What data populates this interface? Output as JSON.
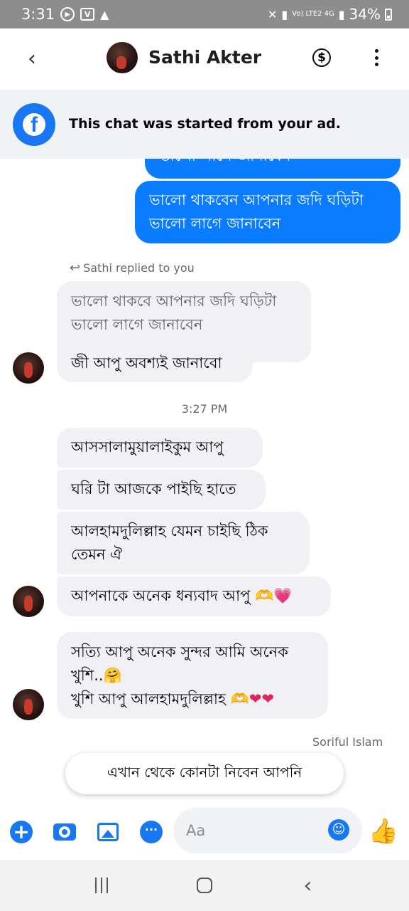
{
  "status_bar": {
    "time": "3:31",
    "battery": "34%",
    "signal_label": "Vo) LTE2 4G"
  },
  "header": {
    "contact_name": "Sathi Akter"
  },
  "ad_banner": {
    "text": "This chat was started from your ad."
  },
  "messages": {
    "out_partial": "ভালো লাগে জানাবেন",
    "out_1_line1": "ভালো থাকবেন আপনার জদি ঘড়িটা",
    "out_1_line2": "ভালো লাগে জানাবেন",
    "reply_note": "Sathi replied to you",
    "quoted_line1": "ভালো থাকবে আপনার জদি ঘড়িটা",
    "quoted_line2": "ভালো লাগে জানাবেন",
    "reply_text": "জী আপু অবশ্যই জানাবো",
    "time_separator": "3:27 PM",
    "in_1": "আসসালামুয়ালাইকুম আপু",
    "in_2": "ঘরি টা আজকে পাইছি হাতে",
    "in_3_line1": "আলহামদুলিল্লাহ যেমন চাইছি ঠিক",
    "in_3_line2": "তেমন ঐ",
    "in_4": "আপনাকে অনেক ধন্যবাদ আপু",
    "in_5_line1": "সত্যি আপু অনেক সুন্দর আমি অনেক",
    "in_5_line2": "খুশি..",
    "in_5_line3": "খুশি আপু আলহামদুলিল্লাহ",
    "sender_label": "Soriful Islam"
  },
  "suggestion": {
    "text": "এখান থেকে কোনটা নিবেন আপনি"
  },
  "composer": {
    "placeholder": "Aa"
  },
  "icons": {
    "back": "chevron-left-icon",
    "payment": "dollar-circle-icon",
    "more": "more-vertical-icon",
    "facebook": "facebook-logo",
    "reply": "reply-arrow-icon",
    "add": "plus-circle-icon",
    "camera": "camera-icon",
    "gallery": "image-icon",
    "chat": "chat-bubble-icon",
    "emoji": "smile-icon",
    "like": "thumbs-up-icon"
  },
  "colors": {
    "accent": "#1877f2",
    "outgoing_bubble": "#0a7cff",
    "incoming_bubble": "#f0f0f5",
    "status_bar": "#8d8d8d"
  }
}
